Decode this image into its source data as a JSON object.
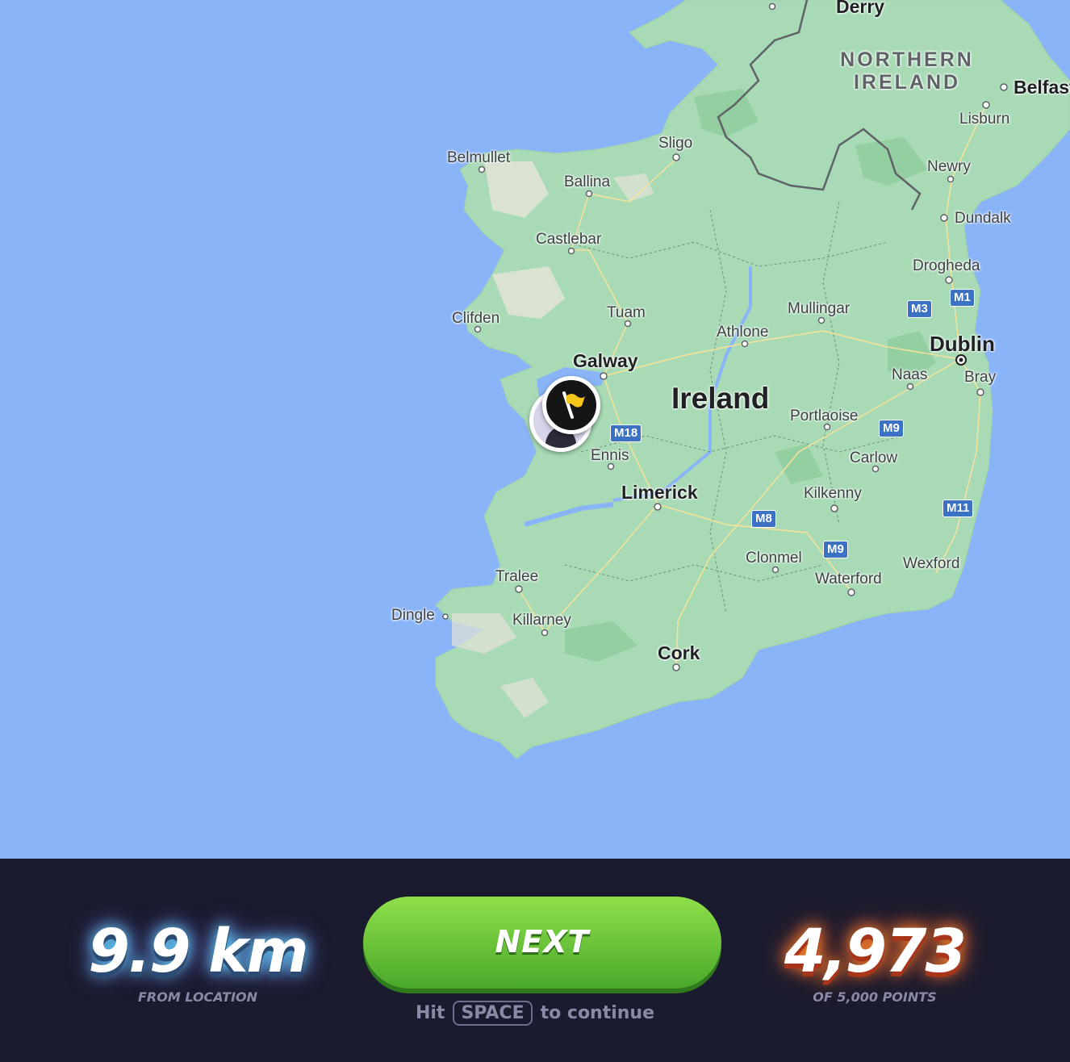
{
  "map": {
    "places": [
      {
        "id": "derry",
        "label": "Derry"
      },
      {
        "id": "northern-ireland",
        "label": "NORTHERN\nIRELAND"
      },
      {
        "id": "belfast",
        "label": "Belfast"
      },
      {
        "id": "lisburn",
        "label": "Lisburn"
      },
      {
        "id": "sligo",
        "label": "Sligo"
      },
      {
        "id": "belmullet",
        "label": "Belmullet"
      },
      {
        "id": "ballina",
        "label": "Ballina"
      },
      {
        "id": "newry",
        "label": "Newry"
      },
      {
        "id": "dundalk",
        "label": "Dundalk"
      },
      {
        "id": "castlebar",
        "label": "Castlebar"
      },
      {
        "id": "drogheda",
        "label": "Drogheda"
      },
      {
        "id": "clifden",
        "label": "Clifden"
      },
      {
        "id": "tuam",
        "label": "Tuam"
      },
      {
        "id": "mullingar",
        "label": "Mullingar"
      },
      {
        "id": "athlone",
        "label": "Athlone"
      },
      {
        "id": "dublin",
        "label": "Dublin"
      },
      {
        "id": "galway",
        "label": "Galway"
      },
      {
        "id": "naas",
        "label": "Naas"
      },
      {
        "id": "bray",
        "label": "Bray"
      },
      {
        "id": "ireland",
        "label": "Ireland"
      },
      {
        "id": "portlaoise",
        "label": "Portlaoise"
      },
      {
        "id": "ennis",
        "label": "Ennis"
      },
      {
        "id": "carlow",
        "label": "Carlow"
      },
      {
        "id": "limerick",
        "label": "Limerick"
      },
      {
        "id": "kilkenny",
        "label": "Kilkenny"
      },
      {
        "id": "clonmel",
        "label": "Clonmel"
      },
      {
        "id": "wexford",
        "label": "Wexford"
      },
      {
        "id": "tralee",
        "label": "Tralee"
      },
      {
        "id": "waterford",
        "label": "Waterford"
      },
      {
        "id": "dingle",
        "label": "Dingle"
      },
      {
        "id": "killarney",
        "label": "Killarney"
      },
      {
        "id": "cork",
        "label": "Cork"
      }
    ],
    "motorways": [
      "M1",
      "M3",
      "M18",
      "M9",
      "M8",
      "M11",
      "M9"
    ]
  },
  "result": {
    "distance": "9.9 km",
    "distance_caption": "FROM LOCATION",
    "next_label": "NEXT",
    "hint_prefix": "Hit",
    "hint_key": "SPACE",
    "hint_suffix": "to continue",
    "score": "4,973",
    "score_caption": "OF 5,000 POINTS"
  },
  "colors": {
    "sea": "#8ab4f8",
    "land": "#a8dab5",
    "panel": "#1b1b2f",
    "button": "#6cc23a"
  }
}
